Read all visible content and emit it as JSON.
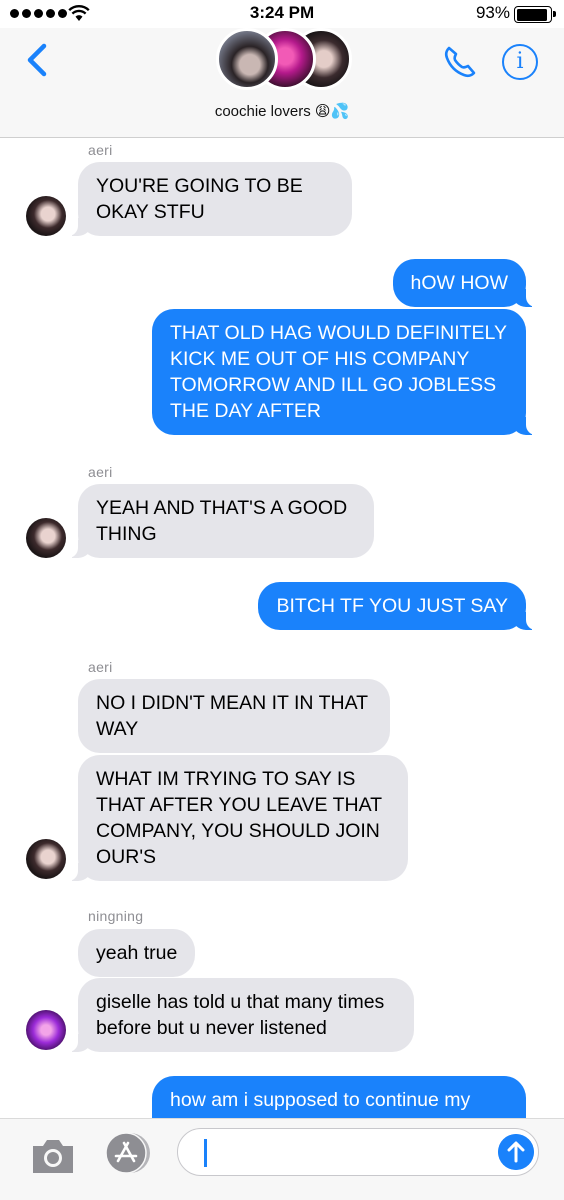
{
  "status_bar": {
    "time": "3:24 PM",
    "battery_percent": "93%",
    "battery_level": 0.93
  },
  "header": {
    "group_name": "coochie lovers 😩💦"
  },
  "messages": [
    {
      "from": "aeri",
      "direction": "incoming",
      "text": "YOU'RE GOING TO BE OKAY STFU"
    },
    {
      "from": "me",
      "direction": "outgoing",
      "text": "hOW HOW"
    },
    {
      "from": "me",
      "direction": "outgoing",
      "text": "THAT OLD HAG WOULD DEFINITELY KICK ME OUT OF HIS COMPANY TOMORROW AND ILL GO JOBLESS THE DAY AFTER"
    },
    {
      "from": "aeri",
      "direction": "incoming",
      "text": "YEAH AND THAT'S A GOOD THING"
    },
    {
      "from": "me",
      "direction": "outgoing",
      "text": "BITCH TF YOU JUST SAY"
    },
    {
      "from": "aeri",
      "direction": "incoming",
      "text": "NO I DIDN'T MEAN IT IN THAT WAY"
    },
    {
      "from": "aeri",
      "direction": "incoming",
      "text": "WHAT IM TRYING TO SAY IS THAT AFTER YOU LEAVE THAT COMPANY, YOU SHOULD JOIN OUR'S"
    },
    {
      "from": "ningning",
      "direction": "incoming",
      "text": "yeah true"
    },
    {
      "from": "ningning",
      "direction": "incoming",
      "text": "giselle has told u that many times before but u never listened"
    },
    {
      "from": "me",
      "direction": "outgoing",
      "text": "how am i supposed to continue my"
    }
  ],
  "senders": {
    "aeri": "aeri",
    "ningning": "ningning"
  },
  "input": {
    "value": ""
  },
  "colors": {
    "accent": "#1a82fb",
    "incoming_bubble": "#e5e5ea"
  }
}
